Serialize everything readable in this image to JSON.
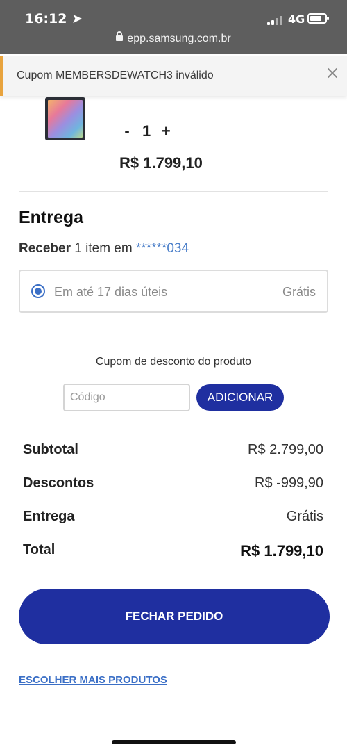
{
  "status_bar": {
    "time": "16:12",
    "network": "4G"
  },
  "browser": {
    "url": "epp.samsung.com.br"
  },
  "toast": {
    "message": "Cupom MEMBERSDEWATCH3 inválido"
  },
  "product": {
    "qty_minus": "-",
    "quantity": "1",
    "qty_plus": "+",
    "price": "R$ 1.799,10"
  },
  "delivery": {
    "title": "Entrega",
    "receive_bold": "Receber",
    "receive_text": "1 item em",
    "masked_address": "******034",
    "option_label": "Em até 17 dias úteis",
    "option_price": "Grátis",
    "radio_color": "#3b6fc6"
  },
  "coupon": {
    "label": "Cupom de desconto do produto",
    "placeholder": "Código",
    "button": "ADICIONAR"
  },
  "summary": {
    "subtotal_label": "Subtotal",
    "subtotal_value": "R$ 2.799,00",
    "discount_label": "Descontos",
    "discount_value": "R$ -999,90",
    "shipping_label": "Entrega",
    "shipping_value": "Grátis",
    "total_label": "Total",
    "total_value": "R$ 1.799,10"
  },
  "actions": {
    "checkout": "FECHAR PEDIDO",
    "more_products": "ESCOLHER MAIS PRODUTOS"
  },
  "colors": {
    "brand": "#1f2fa0",
    "warning": "#e8a33d",
    "link": "#3b6fc6"
  }
}
